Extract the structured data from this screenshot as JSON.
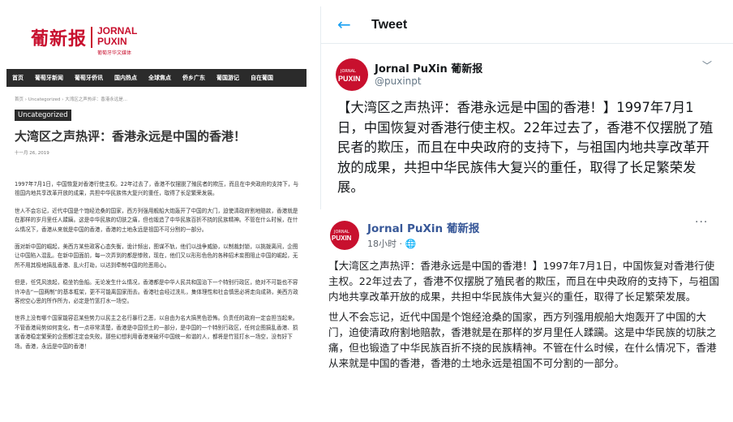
{
  "website": {
    "logo": {
      "cn": "葡新报",
      "en_line1": "JORNAL",
      "en_line2": "PUXIN",
      "sub": "葡萄牙华文媒体"
    },
    "nav": [
      "首页",
      "葡萄牙新闻",
      "葡萄牙侨讯",
      "国内热点",
      "全球焦点",
      "侨乡广东",
      "葡国游记",
      "自在葡国"
    ],
    "breadcrumb": "首页 › Uncategorized › 大湾区之声热评：香港永远是...",
    "category": "Uncategorized",
    "title": "大湾区之声热评：香港永远是中国的香港！",
    "date": "十一月 26, 2019",
    "paragraphs": [
      "1997年7月1日，中国恢复对香港行使主权。22年过去了，香港不仅摆脱了殖民者的欺压，而且在中央政府的支持下，与祖国内地共享改革开放的成果，共担中华民族伟大复兴的重任，取得了长足繁荣发展。",
      "世人不会忘记，近代中国是个饱经沧桑的国家，西方列强用舰船大炮轰开了中国的大门，迫使清政府割地赔款，香港就是在那样的岁月里任人蹂躏。这是中华民族的切肤之痛，但也锻造了中华民族百折不挠的民族精神。不管在什么时候，在什么情况下，香港从来就是中国的香港，香港的土地永远是祖国不可分割的一部分。",
      "面对新中国的崛起，美西方某些政客心态失衡，诡计频出，图谋不轨，他们以战争威胁，以制裁封锁，以挑拨离间，企图让中国陷入混乱。在新中国面前，每一次弄到的都是惨败，现在，他们又以形形色色的各种招术妄图阻止中国的崛起，无所不用其极地搞乱香港、乱火打劫，以达到牵制中国的险恶用心。",
      "但是，任凭风浪起，稳坐钓鱼船。无论发生什么情况，香港都是中华人民共和国治下一个特别行政区，绝对不可能也不容许冲击“一国两制”的基本框架，更不可能离国家而去。香港社会经过洗礼，集体理性和社会慎思必将走向成熟，美西方政客挖空心思的所作所为，必定是竹篮打水一场空。",
      "世界上没有哪个国家能容忍某些势力以民主之名行暴行之恶，以自由为名大搞黑色恐怖。负责任的政府一定会担当起来。不管香港局势如何变化，有一点非常清楚，香港是中国领土的一部分，是中国的一个特别行政区，任何企图搞乱香港、损害香港稳定繁荣的企图都注定会失败。那些幻想利用香港来破坏中国统一和谐的人，都将是竹篮打水一场空，没有好下场。香港，永远是中国的香港！"
    ]
  },
  "tweet": {
    "header_title": "Tweet",
    "account_name": "Jornal PuXin 葡新报",
    "handle": "@puxinpt",
    "avatar_text_top": "JORNAL",
    "avatar_text_main": "PUXIN",
    "text": "【大湾区之声热评：香港永远是中国的香港！】1997年7月1日，中国恢复对香港行使主权。22年过去了，香港不仅摆脱了殖民者的欺压，而且在中央政府的支持下，与祖国内地共享改革开放的成果，共担中华民族伟大复兴的重任，取得了长足繁荣发展。"
  },
  "facebook": {
    "page_name": "Jornal PuXin 葡新报",
    "time": "18小时 · 🌐",
    "avatar_text_top": "JORNAL",
    "avatar_text_main": "PUXIN",
    "paragraphs": [
      "【大湾区之声热评：香港永远是中国的香港！】1997年7月1日，中国恢复对香港行使主权。22年过去了，香港不仅摆脱了殖民者的欺压，而且在中央政府的支持下，与祖国内地共享改革开放的成果，共担中华民族伟大复兴的重任，取得了长足繁荣发展。",
      "世人不会忘记，近代中国是个饱经沧桑的国家，西方列强用舰船大炮轰开了中国的大门，迫使清政府割地赔款，香港就是在那样的岁月里任人蹂躏。这是中华民族的切肤之痛，但也锻造了中华民族百折不挠的民族精神。不管在什么时候，在什么情况下，香港从来就是中国的香港，香港的土地永远是祖国不可分割的一部分。"
    ]
  },
  "colors": {
    "brand_red": "#c8102e",
    "twitter_blue": "#1da1f2",
    "facebook_blue": "#385898"
  }
}
